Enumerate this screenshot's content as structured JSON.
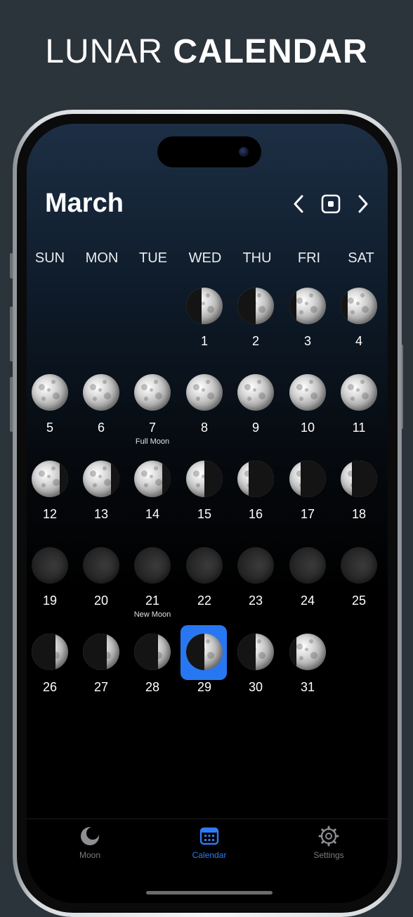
{
  "headline": {
    "light": "LUNAR",
    "bold": "CALENDAR"
  },
  "header": {
    "month": "March"
  },
  "nav": {
    "prev_icon": "chevron-left-icon",
    "today_icon": "today-square-icon",
    "next_icon": "chevron-right-icon"
  },
  "weekdays": [
    "SUN",
    "MON",
    "TUE",
    "WED",
    "THU",
    "FRI",
    "SAT"
  ],
  "days": [
    {
      "n": "1",
      "note": "",
      "phase": "waxing-crescent-half"
    },
    {
      "n": "2",
      "note": "",
      "phase": "first-quarter"
    },
    {
      "n": "3",
      "note": "",
      "phase": "waxing-gibbous"
    },
    {
      "n": "4",
      "note": "",
      "phase": "waxing-gibbous"
    },
    {
      "n": "5",
      "note": "",
      "phase": "full"
    },
    {
      "n": "6",
      "note": "",
      "phase": "full"
    },
    {
      "n": "7",
      "note": "Full Moon",
      "phase": "full"
    },
    {
      "n": "8",
      "note": "",
      "phase": "full"
    },
    {
      "n": "9",
      "note": "",
      "phase": "full"
    },
    {
      "n": "10",
      "note": "",
      "phase": "full"
    },
    {
      "n": "11",
      "note": "",
      "phase": "full"
    },
    {
      "n": "12",
      "note": "",
      "phase": "waning-gibbous"
    },
    {
      "n": "13",
      "note": "",
      "phase": "waning-gibbous"
    },
    {
      "n": "14",
      "note": "",
      "phase": "waning-gibbous"
    },
    {
      "n": "15",
      "note": "",
      "phase": "last-quarter"
    },
    {
      "n": "16",
      "note": "",
      "phase": "waning-crescent"
    },
    {
      "n": "17",
      "note": "",
      "phase": "waning-crescent"
    },
    {
      "n": "18",
      "note": "",
      "phase": "waning-crescent"
    },
    {
      "n": "19",
      "note": "",
      "phase": "new"
    },
    {
      "n": "20",
      "note": "",
      "phase": "new"
    },
    {
      "n": "21",
      "note": "New Moon",
      "phase": "new"
    },
    {
      "n": "22",
      "note": "",
      "phase": "new"
    },
    {
      "n": "23",
      "note": "",
      "phase": "new"
    },
    {
      "n": "24",
      "note": "",
      "phase": "new"
    },
    {
      "n": "25",
      "note": "",
      "phase": "new"
    },
    {
      "n": "26",
      "note": "",
      "phase": "waxing-crescent"
    },
    {
      "n": "27",
      "note": "",
      "phase": "waxing-crescent"
    },
    {
      "n": "28",
      "note": "",
      "phase": "waxing-crescent"
    },
    {
      "n": "29",
      "note": "",
      "phase": "first-quarter",
      "selected": true
    },
    {
      "n": "30",
      "note": "",
      "phase": "first-quarter"
    },
    {
      "n": "31",
      "note": "",
      "phase": "waxing-gibbous"
    }
  ],
  "tabs": [
    {
      "label": "Moon",
      "icon": "moon-icon",
      "active": false
    },
    {
      "label": "Calendar",
      "icon": "calendar-icon",
      "active": true
    },
    {
      "label": "Settings",
      "icon": "gear-icon",
      "active": false
    }
  ],
  "colors": {
    "accent": "#2877f2",
    "background": "#2b333b"
  }
}
